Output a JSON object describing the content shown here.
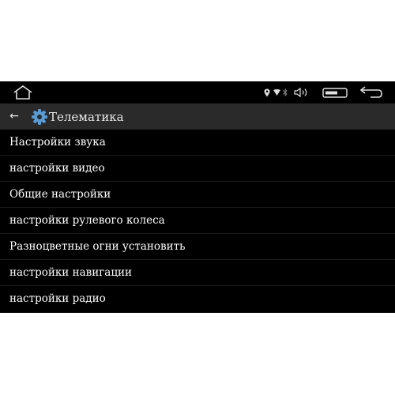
{
  "title": "Телематика",
  "menu": [
    "Настройки звука",
    "настройки видео",
    "Общие настройки",
    "настройки рулевого колеса",
    "Разноцветные огни установить",
    "настройки навигации",
    "настройки радио"
  ],
  "icons": {
    "home": "home-icon",
    "location": "location-icon",
    "wifi": "wifi-icon",
    "bluetooth": "bluetooth-icon",
    "volume": "volume-icon",
    "window": "window-icon",
    "back": "back-icon",
    "title_back": "back-arrow-icon",
    "title_gear": "gear-icon"
  },
  "colors": {
    "background": "#000000",
    "titlebar": "#2a2a2a",
    "gear": "#5b9bd5",
    "text": "#ffffff"
  }
}
